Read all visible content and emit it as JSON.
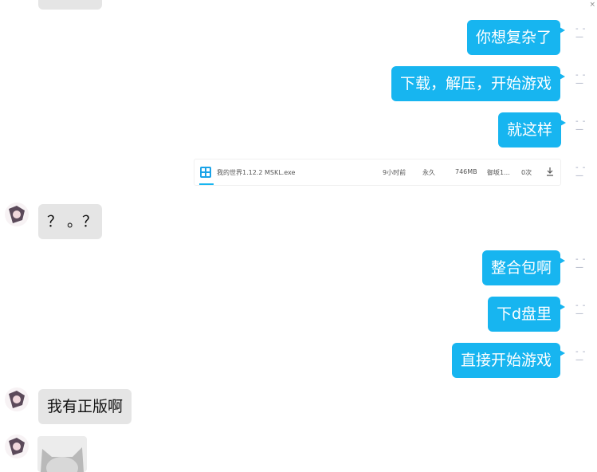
{
  "messages": [
    {
      "side": "me",
      "text": "你想复杂了"
    },
    {
      "side": "me",
      "text": "下载，解压，开始游戏"
    },
    {
      "side": "me",
      "text": "就这样"
    },
    {
      "side": "them",
      "text": "？ 。？"
    },
    {
      "side": "me",
      "text": "整合包啊"
    },
    {
      "side": "me",
      "text": "下d盘里"
    },
    {
      "side": "me",
      "text": "直接开始游戏"
    },
    {
      "side": "them",
      "text": "我有正版啊"
    }
  ],
  "file": {
    "name": "我的世界1.12.2 MSKL.exe",
    "time": "9小时前",
    "validity": "永久",
    "size": "746MB",
    "location": "御坂1...",
    "downloads": "0次"
  },
  "colors": {
    "my_bubble": "#17b5f0",
    "their_bubble": "#e5e5e5"
  }
}
